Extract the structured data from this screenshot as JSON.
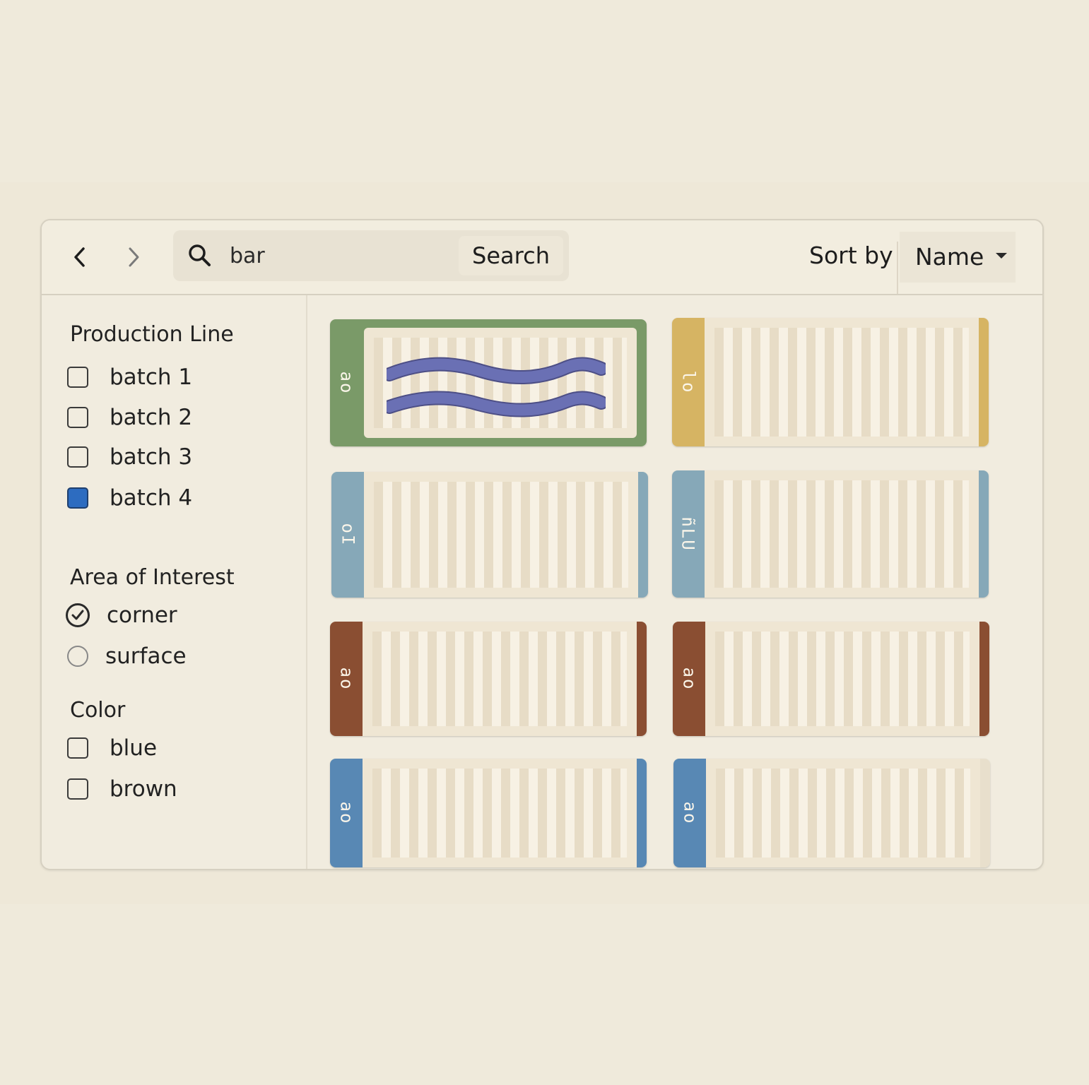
{
  "toolbar": {
    "search_value": "bar",
    "search_button": "Search",
    "sort_label": "Sort by",
    "sort_value": "Name"
  },
  "filters": {
    "production_line": {
      "heading": "Production Line",
      "options": [
        {
          "label": "batch 1",
          "checked": false
        },
        {
          "label": "batch 2",
          "checked": false
        },
        {
          "label": "batch 3",
          "checked": false
        },
        {
          "label": "batch 4",
          "checked": true
        }
      ]
    },
    "area_of_interest": {
      "heading": "Area of Interest",
      "options": [
        {
          "label": "corner",
          "selected": true
        },
        {
          "label": "surface",
          "selected": false
        }
      ]
    },
    "color": {
      "heading": "Color",
      "options": [
        {
          "label": "blue",
          "checked": false
        },
        {
          "label": "brown",
          "checked": false
        }
      ]
    }
  },
  "results": [
    {
      "code": "ao",
      "tab_color": "#7a9a68",
      "marking": "wave-lines"
    },
    {
      "code": "lo",
      "tab_color": "#d6b463"
    },
    {
      "code": "oI",
      "tab_color": "#86a8b8"
    },
    {
      "code": "ñLU",
      "tab_color": "#86a8b8"
    },
    {
      "code": "ao",
      "tab_color": "#8a4e32"
    },
    {
      "code": "ao",
      "tab_color": "#8a4e32"
    },
    {
      "code": "ao",
      "tab_color": "#5888b4"
    },
    {
      "code": "ao",
      "tab_color": "#5888b4"
    }
  ],
  "colors": {
    "accent_checkbox": "#2d6cc0",
    "wave_stroke": "#6a70b4"
  }
}
